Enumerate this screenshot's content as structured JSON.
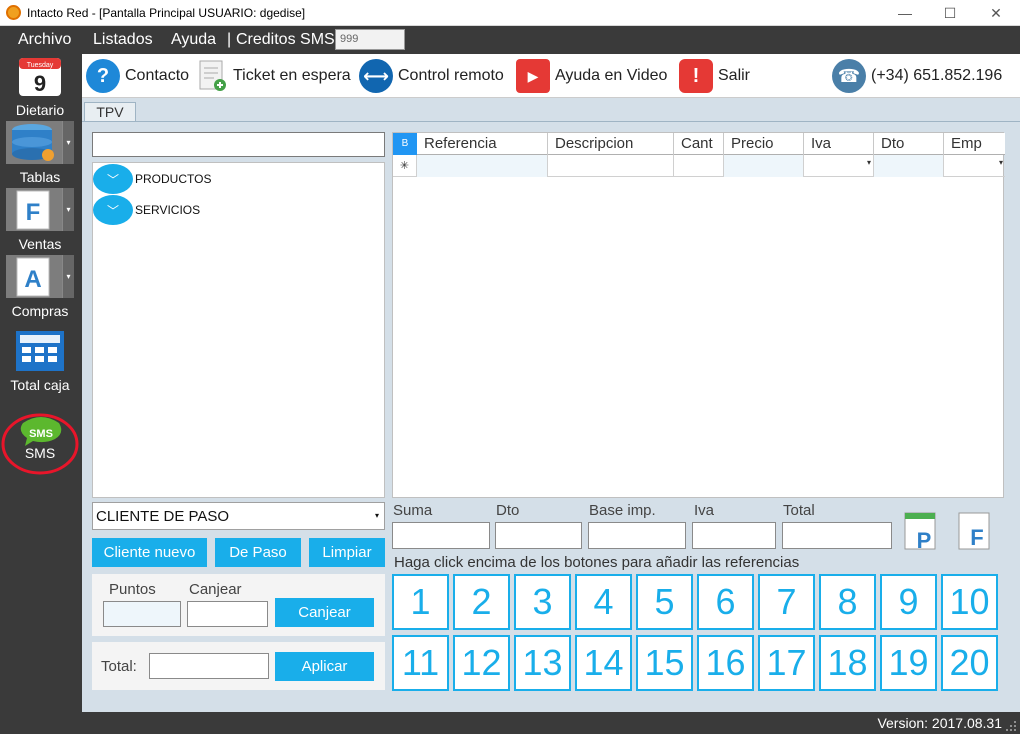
{
  "window": {
    "title": "Intacto Red - [Pantalla Principal USUARIO: dgedise]",
    "minimize": "—",
    "maximize": "☐",
    "close": "✕"
  },
  "menu": {
    "archivo": "Archivo",
    "listados": "Listados",
    "ayuda": "Ayuda",
    "separator": "|",
    "creditos_label": "Creditos SMS",
    "creditos_value": "999"
  },
  "sidebar": {
    "calendar_month": "Tuesday",
    "calendar_day": "9",
    "dietario": "Dietario",
    "tablas": "Tablas",
    "ventas": "Ventas",
    "ventas_icon_letter": "F",
    "compras": "Compras",
    "compras_icon_letter": "A",
    "total_caja": "Total caja",
    "sms_badge": "SMS",
    "sms": "SMS",
    "dropdown_arrow": "▾"
  },
  "toolbar": {
    "contacto": "Contacto",
    "contacto_glyph": "?",
    "ticket": "Ticket en espera",
    "control": "Control remoto",
    "control_glyph": "⟷",
    "video": "Ayuda en Video",
    "video_glyph": "▶",
    "salir": "Salir",
    "salir_glyph": "!",
    "phone_glyph": "☎",
    "phone": "(+34) 651.852.196"
  },
  "tabs": {
    "tpv": "TPV"
  },
  "tree": {
    "toggle_glyph": "﹀",
    "productos": "PRODUCTOS",
    "servicios": "SERVICIOS"
  },
  "grid": {
    "corner": "B",
    "new_row_marker": "✳",
    "drop_glyph": "▾",
    "columns": [
      "Referencia",
      "Descripcion",
      "Cant",
      "Precio",
      "Iva",
      "Dto",
      "Emp"
    ]
  },
  "client": {
    "selected": "CLIENTE DE PASO",
    "drop_glyph": "▾",
    "cliente_nuevo": "Cliente nuevo",
    "de_paso": "De Paso",
    "limpiar": "Limpiar"
  },
  "points": {
    "puntos": "Puntos",
    "canjear_label": "Canjear",
    "canjear_button": "Canjear",
    "puntos_value": "",
    "canjear_value": ""
  },
  "total_box": {
    "label": "Total:",
    "aplicar": "Aplicar",
    "value": ""
  },
  "summary": {
    "suma": "Suma",
    "dto": "Dto",
    "base": "Base imp.",
    "iva": "Iva",
    "total": "Total",
    "p_letter": "P",
    "f_letter": "F"
  },
  "hint": "Haga click encima de los botones para añadir las referencias",
  "number_buttons": [
    "1",
    "2",
    "3",
    "4",
    "5",
    "6",
    "7",
    "8",
    "9",
    "10",
    "11",
    "12",
    "13",
    "14",
    "15",
    "16",
    "17",
    "18",
    "19",
    "20"
  ],
  "status": {
    "version": "Version: 2017.08.31"
  },
  "colors": {
    "accent": "#19aeea",
    "sidebar": "#3a3a3a",
    "panel": "#d4dfe8",
    "highlight": "#e8152a"
  }
}
